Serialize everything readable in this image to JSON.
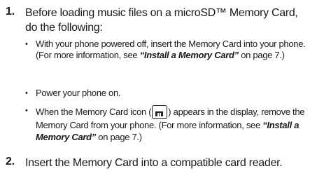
{
  "steps": [
    {
      "number": "1.",
      "line1": "Before loading music files on a microSD™ Memory Card,",
      "line2": "do the following:",
      "bullets": [
        {
          "text_a": "With your phone powered off, insert the Memory Card into your phone. (For more information, see ",
          "ref": "“Install a Memory Card”",
          "text_b": " on page 7.)"
        },
        {
          "text": "Power your phone on."
        },
        {
          "text_a": "When the Memory Card icon (",
          "icon": "memory-card-icon",
          "text_b": ") appears in the display, remove the Memory Card from your phone. (For more information, see ",
          "ref": "“Install a Memory Card”",
          "text_c": " on page 7.)"
        }
      ]
    },
    {
      "number": "2.",
      "line1": "Insert the Memory Card into a compatible card reader."
    }
  ]
}
